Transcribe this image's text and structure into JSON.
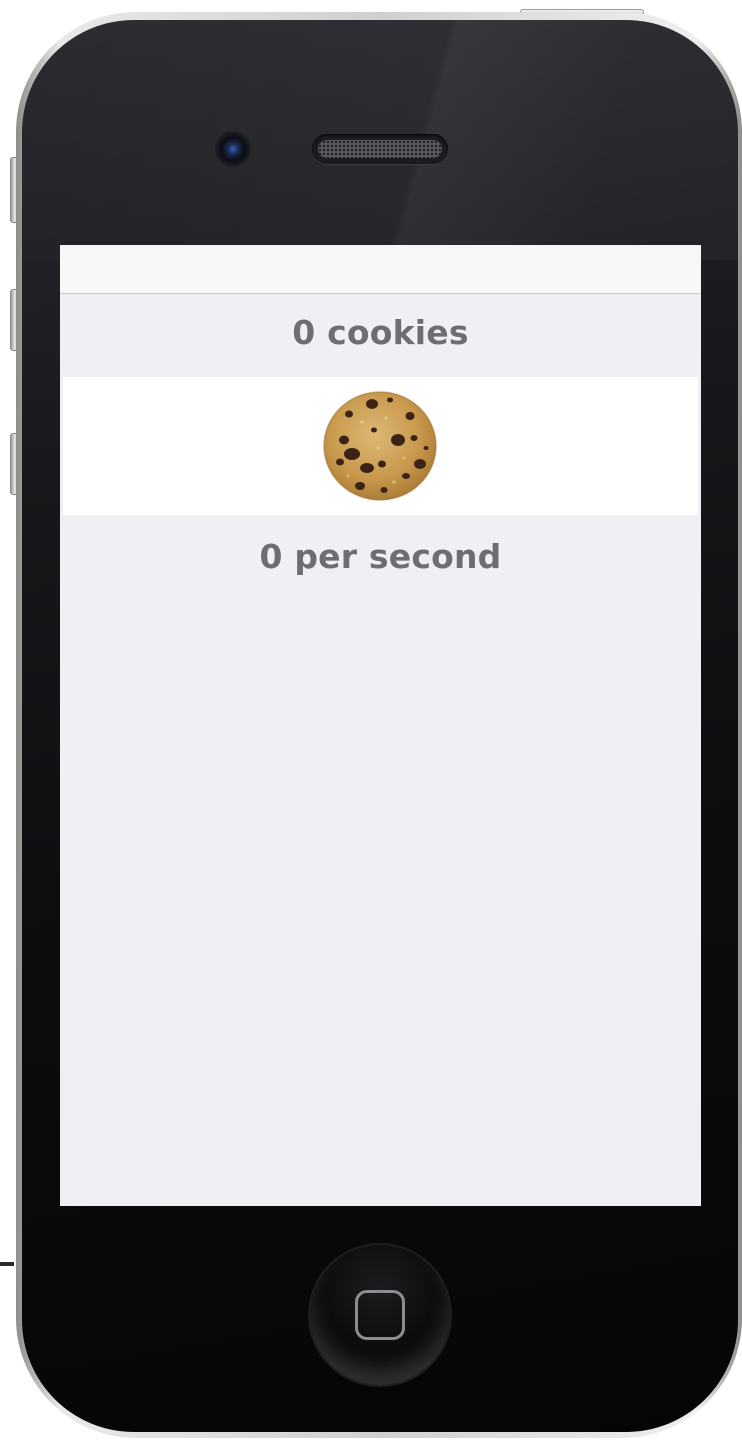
{
  "device": {
    "model": "iPhone 4",
    "frame_color": "#cfcfcf",
    "body_color": "#0c0d0f"
  },
  "app": {
    "cookie_count_text": "0 cookies",
    "cookies_per_second_text": "0 per second",
    "cookie_image": "chocolate-chip-cookie",
    "background_color": "#efeff4",
    "text_color": "#6d6d72"
  }
}
